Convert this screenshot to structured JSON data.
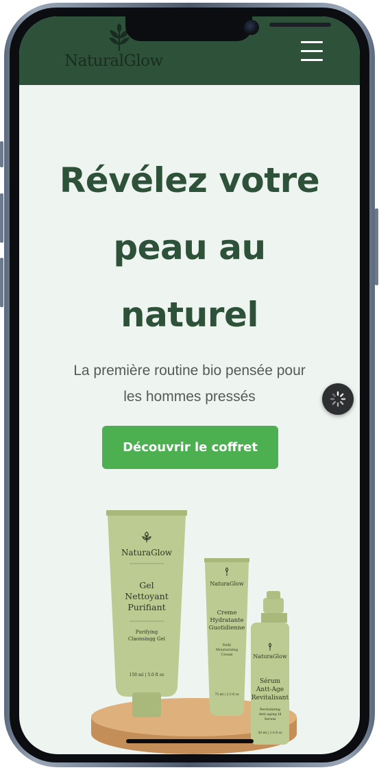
{
  "brand": {
    "name": "NaturalGlow"
  },
  "header": {
    "menu_icon": "hamburger-menu-icon",
    "background": "#2e5139"
  },
  "hero": {
    "title_lines": [
      "Révélez votre",
      "peau au",
      "naturel"
    ],
    "subtitle_lines": [
      "La première routine bio pensée pour",
      "les hommes pressés"
    ],
    "cta_label": "Découvrir le coffret",
    "cta_color": "#4caf50"
  },
  "products": [
    {
      "brand": "NaturaGlow",
      "name_lines": [
        "Gel",
        "Nettoyant",
        "Purifiant"
      ],
      "desc_lines": [
        "Purifying",
        "Claonsingg Gel"
      ],
      "volume": "150 ml | 5.0 fl oz"
    },
    {
      "brand": "NaturaGlow",
      "name_lines": [
        "Creme",
        "Hydratante",
        "Guotidienne"
      ],
      "desc_lines": [
        "Daily",
        "Moisturizing",
        "Cream"
      ],
      "volume": "75 ml | 2.5 fl oz"
    },
    {
      "brand": "NaturaGlow",
      "name_lines": [
        "Sérum",
        "Antt-Age",
        "Revitalisant"
      ],
      "desc_lines": [
        "Revitalizing",
        "Anti-aging Id",
        "Serum"
      ],
      "volume": "30 ml | 1.0 fl oz"
    }
  ],
  "floating": {
    "icon": "loading-spinner-icon"
  },
  "colors": {
    "page_bg": "#eef4ef",
    "title": "#2e5139",
    "product_body": "#b9c98f",
    "pedestal": "#d9ab78"
  }
}
